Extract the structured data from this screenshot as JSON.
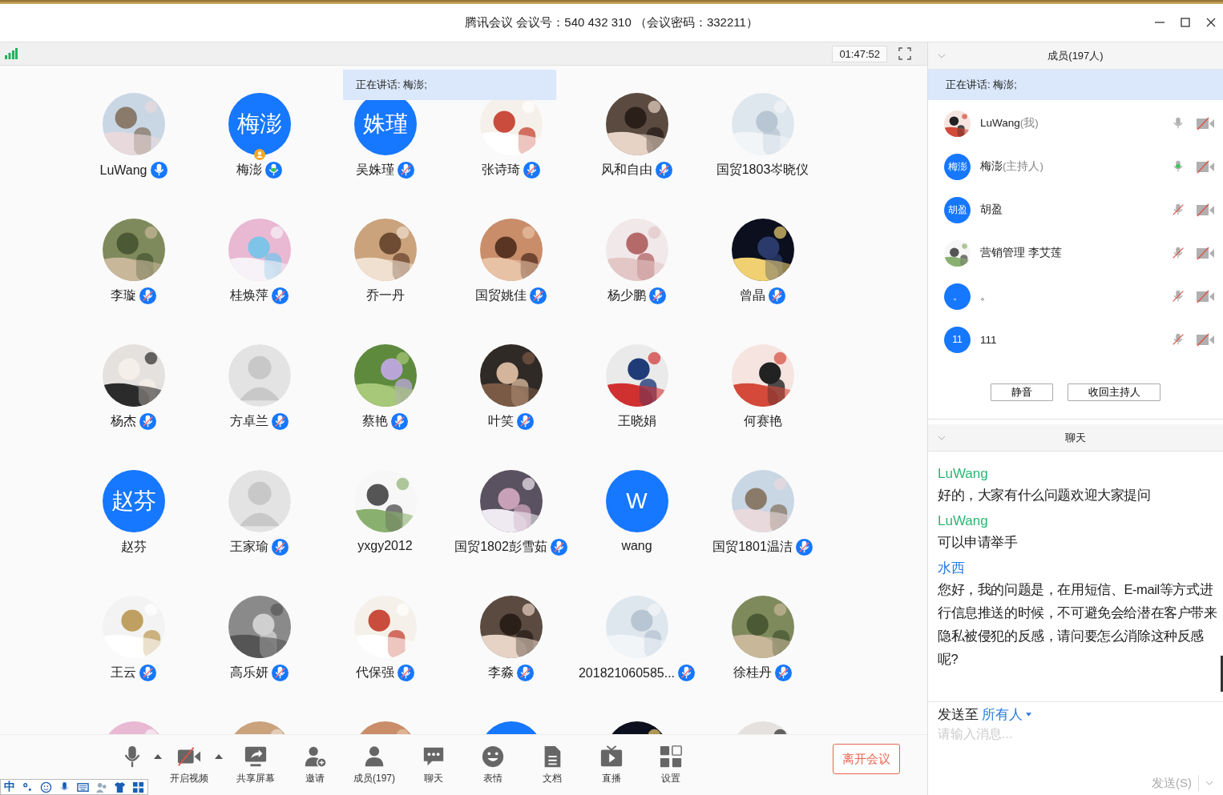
{
  "window": {
    "title": "腾讯会议 会议号：540 432 310 （会议密码：332211）"
  },
  "meeting_bar": {
    "timer": "01:47:52"
  },
  "speaking_banner": "正在讲话: 梅澎;",
  "participants": [
    {
      "name": "LuWang",
      "kind": "picture",
      "mic_shown": true,
      "muted": false,
      "speaking": false,
      "host": false
    },
    {
      "name": "梅澎",
      "kind": "initials",
      "initials": "梅澎",
      "mic_shown": true,
      "muted": false,
      "speaking": true,
      "host": true
    },
    {
      "name": "吴姝瑾",
      "kind": "initials",
      "initials": "姝瑾",
      "mic_shown": true,
      "muted": true,
      "speaking": false,
      "host": false
    },
    {
      "name": "张诗琦",
      "kind": "picture",
      "mic_shown": true,
      "muted": true,
      "speaking": false,
      "host": false
    },
    {
      "name": "风和自由",
      "kind": "picture",
      "mic_shown": true,
      "muted": true,
      "speaking": false,
      "host": false
    },
    {
      "name": "国贸1803岑晓仪",
      "kind": "picture",
      "mic_shown": false,
      "host": false
    },
    {
      "name": "李璇",
      "kind": "picture",
      "mic_shown": true,
      "muted": true,
      "speaking": false,
      "host": false
    },
    {
      "name": "桂焕萍",
      "kind": "picture",
      "mic_shown": true,
      "muted": true,
      "speaking": false,
      "host": false
    },
    {
      "name": "乔一丹",
      "kind": "picture",
      "mic_shown": false,
      "host": false
    },
    {
      "name": "国贸姚佳",
      "kind": "picture",
      "mic_shown": true,
      "muted": true,
      "speaking": false,
      "host": false
    },
    {
      "name": "杨少鹏",
      "kind": "picture",
      "mic_shown": true,
      "muted": true,
      "speaking": false,
      "host": false
    },
    {
      "name": "曾晶",
      "kind": "picture",
      "mic_shown": true,
      "muted": true,
      "speaking": false,
      "host": false
    },
    {
      "name": "杨杰",
      "kind": "picture",
      "mic_shown": true,
      "muted": true,
      "speaking": false,
      "host": false
    },
    {
      "name": "方卓兰",
      "kind": "default",
      "mic_shown": true,
      "muted": true,
      "speaking": false,
      "host": false
    },
    {
      "name": "蔡艳",
      "kind": "picture",
      "mic_shown": true,
      "muted": true,
      "speaking": false,
      "host": false
    },
    {
      "name": "叶笑",
      "kind": "picture",
      "mic_shown": true,
      "muted": true,
      "speaking": false,
      "host": false
    },
    {
      "name": "王晓娟",
      "kind": "picture",
      "mic_shown": false,
      "host": false
    },
    {
      "name": "何赛艳",
      "kind": "picture",
      "mic_shown": false,
      "host": false
    },
    {
      "name": "赵芬",
      "kind": "initials",
      "initials": "赵芬",
      "mic_shown": false,
      "host": false
    },
    {
      "name": "王家瑜",
      "kind": "default",
      "mic_shown": true,
      "muted": true,
      "speaking": false,
      "host": false
    },
    {
      "name": "yxgy2012",
      "kind": "picture",
      "mic_shown": false,
      "host": false
    },
    {
      "name": "国贸1802彭雪茹",
      "kind": "picture",
      "mic_shown": true,
      "muted": true,
      "speaking": false,
      "host": false
    },
    {
      "name": "wang",
      "kind": "initials",
      "initials": "W",
      "mic_shown": false,
      "host": false
    },
    {
      "name": "国贸1801温洁",
      "kind": "picture",
      "mic_shown": true,
      "muted": true,
      "speaking": false,
      "host": false
    },
    {
      "name": "王云",
      "kind": "picture",
      "mic_shown": true,
      "muted": true,
      "speaking": false,
      "host": false
    },
    {
      "name": "高乐妍",
      "kind": "picture",
      "mic_shown": true,
      "muted": true,
      "speaking": false,
      "host": false
    },
    {
      "name": "代保强",
      "kind": "picture",
      "mic_shown": true,
      "muted": true,
      "speaking": false,
      "host": false
    },
    {
      "name": "李淼",
      "kind": "picture",
      "mic_shown": true,
      "muted": true,
      "speaking": false,
      "host": false
    },
    {
      "name": "201821060585...",
      "kind": "picture",
      "mic_shown": true,
      "muted": true,
      "speaking": false,
      "host": false
    },
    {
      "name": "徐桂丹",
      "kind": "picture",
      "mic_shown": true,
      "muted": true,
      "speaking": false,
      "host": false
    },
    {
      "kind": "picture"
    },
    {
      "kind": "picture"
    },
    {
      "kind": "picture"
    },
    {
      "kind": "initials"
    },
    {
      "kind": "picture"
    },
    {
      "kind": "picture"
    }
  ],
  "toolbar": [
    {
      "kind": "mic",
      "menu": true
    },
    {
      "kind": "video",
      "label": "开启视频",
      "menu": true
    },
    {
      "kind": "share",
      "label": "共享屏幕",
      "menu": false
    },
    {
      "kind": "invite",
      "label": "邀请",
      "menu": false
    },
    {
      "kind": "members",
      "label": "成员(197)",
      "menu": false
    },
    {
      "kind": "chat",
      "label": "聊天",
      "menu": false
    },
    {
      "kind": "emoji",
      "label": "表情",
      "menu": false
    },
    {
      "kind": "doc",
      "label": "文档",
      "menu": false
    },
    {
      "kind": "live",
      "label": "直播",
      "menu": false
    },
    {
      "kind": "settings",
      "label": "设置",
      "menu": false
    }
  ],
  "leave_button": "离开会议",
  "ime_bar": {
    "mode": "中"
  },
  "members_panel": {
    "title": "成员(197人)",
    "speaking": "正在讲话: 梅澎;",
    "members": [
      {
        "name": "LuWang",
        "role": "(我)",
        "kind": "picture",
        "muted": false,
        "speaking": false,
        "camera_on": false
      },
      {
        "name": "梅澎",
        "role": "(主持人)",
        "kind": "initials",
        "initials": "梅澎",
        "muted": false,
        "speaking": true,
        "camera_on": false
      },
      {
        "name": "胡盈",
        "kind": "initials",
        "initials": "胡盈",
        "muted": true,
        "speaking": false,
        "camera_on": false
      },
      {
        "name": "营销管理 李艾莲",
        "kind": "picture",
        "muted": true,
        "speaking": false,
        "camera_on": false
      },
      {
        "name": "。",
        "kind": "initials",
        "initials": "。",
        "muted": true,
        "speaking": false,
        "camera_on": false
      },
      {
        "name": "111",
        "kind": "initials",
        "initials": "11",
        "muted": true,
        "speaking": false,
        "camera_on": false
      }
    ],
    "buttons": [
      "静音",
      "收回主持人"
    ]
  },
  "chat_panel": {
    "title": "聊天",
    "messages": [
      {
        "sender": "LuWang",
        "color": "#2bb673",
        "text": "好的，大家有什么问题欢迎大家提问"
      },
      {
        "sender": "LuWang",
        "color": "#2bb673",
        "text": "可以申请举手"
      },
      {
        "sender": "水西",
        "color": "#2a7ae2",
        "text": "您好，我的问题是，在用短信、E-mail等方式进行信息推送的时候，不可避免会给潜在客户带来隐私被侵犯的反感，请问要怎么消除这种反感呢?"
      }
    ],
    "send_to_label": "发送至",
    "recipient": "所有人",
    "placeholder": "请输入消息...",
    "send_button": "发送(S)"
  }
}
